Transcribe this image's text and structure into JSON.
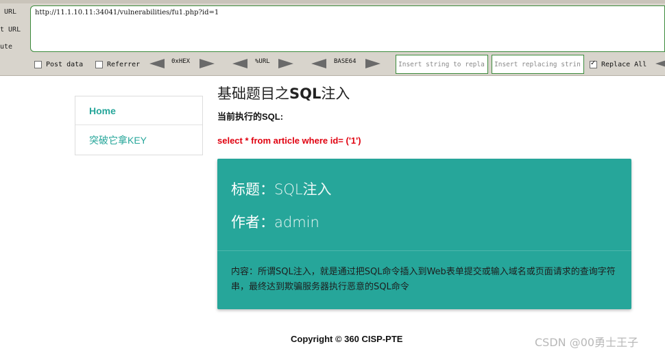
{
  "hackbar": {
    "side_labels": [
      "URL",
      "t URL",
      "ute"
    ],
    "url_value": "http://11.1.10.11:34041/vulnerabilities/fu1.php?id=1",
    "post_data_label": "Post data",
    "referrer_label": "Referrer",
    "post_data_checked": false,
    "referrer_checked": false,
    "encoders": [
      "0xHEX",
      "%URL",
      "BASE64"
    ],
    "insert_string_placeholder": "Insert string to repla",
    "insert_replacing_placeholder": "Insert replacing strin",
    "replace_all_label": "Replace All",
    "replace_all_checked": true
  },
  "sidebar": {
    "items": [
      {
        "label": "Home"
      },
      {
        "label": "突破它拿KEY"
      }
    ]
  },
  "main": {
    "title_prefix": "基础题目之",
    "title_bold": "SQL",
    "title_suffix": "注入",
    "sql_label": "当前执行的SQL:",
    "sql_query": "select * from article where id= ('1')",
    "card": {
      "title_label": "标题：",
      "title_value": "SQL注入",
      "author_label": "作者：",
      "author_value": "admin",
      "content": "内容：所谓SQL注入，就是通过把SQL命令插入到Web表单提交或输入域名或页面请求的查询字符串，最终达到欺骗服务器执行恶意的SQL命令"
    }
  },
  "footer": {
    "copyright": "Copyright © 360 CISP-PTE",
    "watermark": "CSDN @00勇士王子"
  },
  "colors": {
    "accent": "#26a69a",
    "sql_red": "#e0000f",
    "toolbar_bg": "#d8d4cc"
  }
}
